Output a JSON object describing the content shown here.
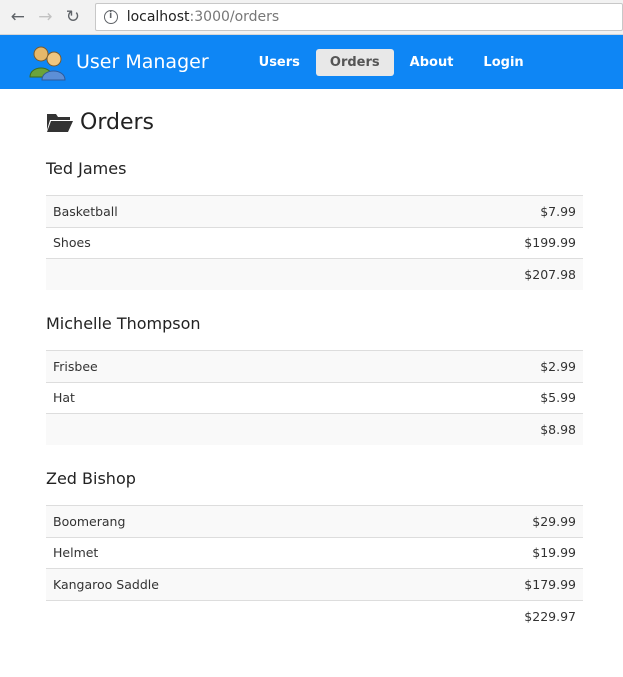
{
  "browser": {
    "back_icon": "←",
    "forward_icon": "→",
    "reload_icon": "↻",
    "url_host": "localhost",
    "url_path": ":3000/orders"
  },
  "navbar": {
    "brand": "User Manager",
    "links": [
      {
        "label": "Users",
        "active": false
      },
      {
        "label": "Orders",
        "active": true
      },
      {
        "label": "About",
        "active": false
      },
      {
        "label": "Login",
        "active": false
      }
    ],
    "accent": "#0e86f5"
  },
  "page": {
    "title": "Orders"
  },
  "customers": [
    {
      "name": "Ted James",
      "items": [
        {
          "product": "Basketball",
          "price": "$7.99"
        },
        {
          "product": "Shoes",
          "price": "$199.99"
        }
      ],
      "total": "$207.98"
    },
    {
      "name": "Michelle Thompson",
      "items": [
        {
          "product": "Frisbee",
          "price": "$2.99"
        },
        {
          "product": "Hat",
          "price": "$5.99"
        }
      ],
      "total": "$8.98"
    },
    {
      "name": "Zed Bishop",
      "items": [
        {
          "product": "Boomerang",
          "price": "$29.99"
        },
        {
          "product": "Helmet",
          "price": "$19.99"
        },
        {
          "product": "Kangaroo Saddle",
          "price": "$179.99"
        }
      ],
      "total": "$229.97"
    }
  ]
}
